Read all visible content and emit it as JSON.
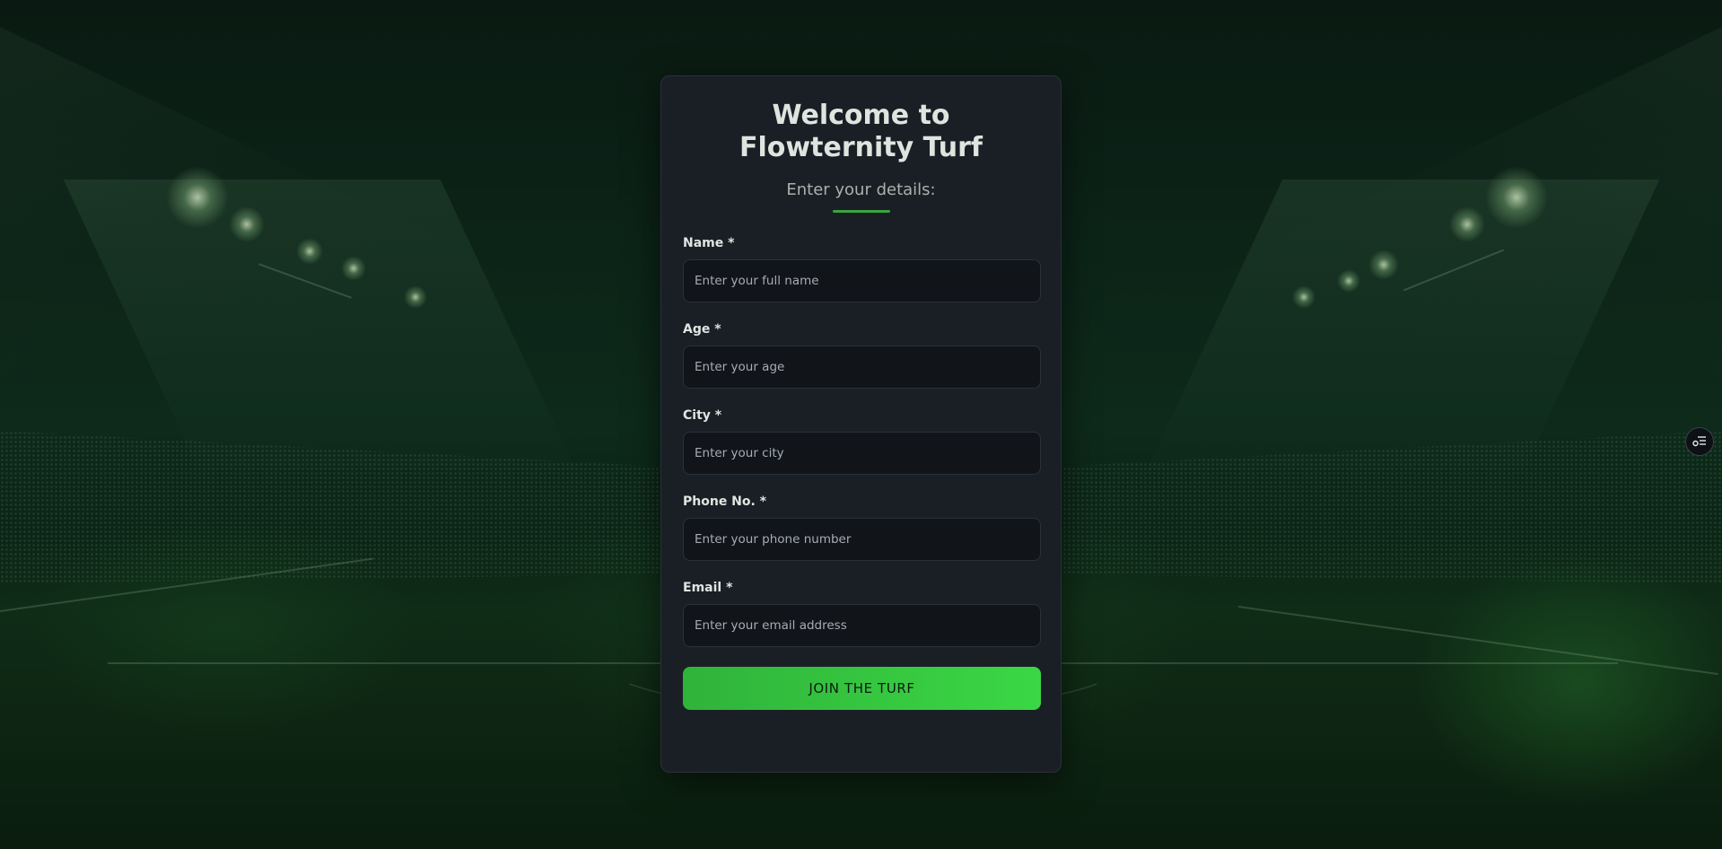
{
  "form": {
    "title": "Welcome to Flowternity Turf",
    "subtitle": "Enter your details:",
    "fields": [
      {
        "label": "Name *",
        "placeholder": "Enter your full name",
        "value": ""
      },
      {
        "label": "Age *",
        "placeholder": "Enter your age",
        "value": ""
      },
      {
        "label": "City *",
        "placeholder": "Enter your city",
        "value": ""
      },
      {
        "label": "Phone No. *",
        "placeholder": "Enter your phone number",
        "value": ""
      },
      {
        "label": "Email *",
        "placeholder": "Enter your email address",
        "value": ""
      }
    ],
    "submit_label": "JOIN THE TURF"
  },
  "colors": {
    "accent": "#3bd745",
    "card_bg": "#1a1f26",
    "input_bg": "#111419"
  },
  "icons": {
    "side_toggle": "settings-list-icon"
  }
}
